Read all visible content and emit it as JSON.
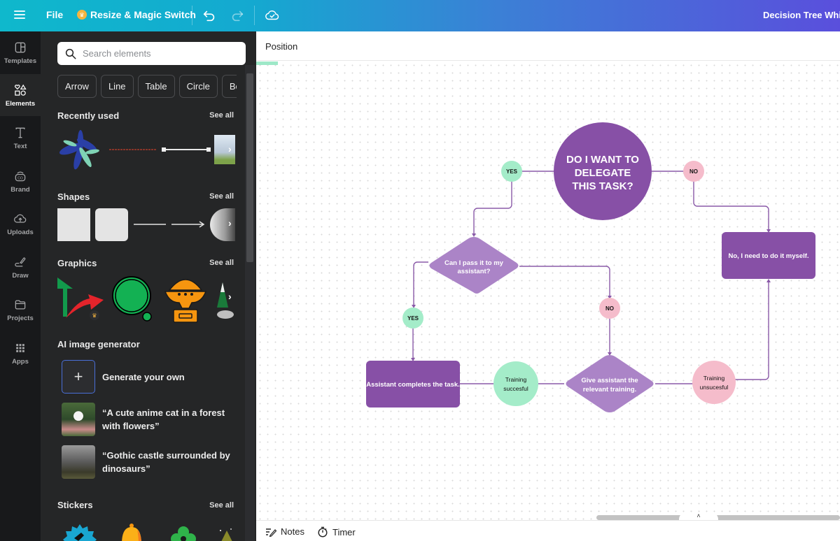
{
  "topbar": {
    "file_label": "File",
    "resize_label": "Resize & Magic Switch",
    "document_title": "Decision Tree Whiteboard",
    "icons": [
      "hamburger-menu-icon",
      "crown-icon",
      "undo-icon",
      "redo-icon",
      "cloud-saved-icon"
    ]
  },
  "rail": {
    "items": [
      {
        "label": "Templates",
        "icon": "templates-icon",
        "active": false
      },
      {
        "label": "Elements",
        "icon": "elements-icon",
        "active": true
      },
      {
        "label": "Text",
        "icon": "text-icon",
        "active": false
      },
      {
        "label": "Brand",
        "icon": "brand-icon",
        "active": false
      },
      {
        "label": "Uploads",
        "icon": "uploads-icon",
        "active": false
      },
      {
        "label": "Draw",
        "icon": "draw-icon",
        "active": false
      },
      {
        "label": "Projects",
        "icon": "folder-icon",
        "active": false
      },
      {
        "label": "Apps",
        "icon": "apps-grid-icon",
        "active": false
      }
    ]
  },
  "panel": {
    "search_placeholder": "Search elements",
    "chips": [
      "Arrow",
      "Line",
      "Table",
      "Circle",
      "Box"
    ],
    "sections": {
      "recently_used": {
        "title": "Recently used",
        "see_all": "See all"
      },
      "shapes": {
        "title": "Shapes",
        "see_all": "See all"
      },
      "graphics": {
        "title": "Graphics",
        "see_all": "See all"
      },
      "ai_generator": {
        "title": "AI image generator"
      },
      "stickers": {
        "title": "Stickers",
        "see_all": "See all"
      }
    },
    "ai_items": [
      {
        "label": "Generate your own"
      },
      {
        "label": "“A cute anime cat in a forest with flowers”"
      },
      {
        "label": "“Gothic castle surrounded by dinosaurs”"
      }
    ]
  },
  "canvas": {
    "position_label": "Position",
    "colors": {
      "purple_dark": "#8750a6",
      "purple_light": "#ab84c7",
      "mint": "#a4ecc9",
      "pink": "#f5bccb",
      "connector": "#8a5aa8"
    },
    "nodes": {
      "main_question": [
        "DO I WANT TO",
        "DELEGATE",
        "THIS TASK?"
      ],
      "yes_top": "YES",
      "no_top": "NO",
      "pass_question": [
        "Can I pass it to my",
        "assistant?"
      ],
      "do_myself": "No, I need to do it myself.",
      "yes_mid": "YES",
      "no_mid": "NO",
      "assistant_completes": "Assistant completes the task.",
      "training_success": [
        "Training",
        "succesful"
      ],
      "give_training": [
        "Give assistant the",
        "relevant training."
      ],
      "training_fail": [
        "Training",
        "unsucesful"
      ]
    }
  },
  "bottombar": {
    "notes_label": "Notes",
    "timer_label": "Timer"
  }
}
